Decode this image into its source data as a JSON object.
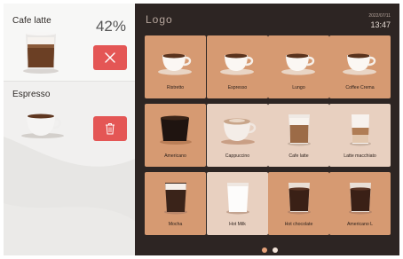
{
  "queue": [
    {
      "name": "Cafe latte",
      "progress_text": "42%",
      "progress_fraction": 0.42
    },
    {
      "name": "Espresso"
    }
  ],
  "header": {
    "logo": "Logo",
    "date": "2022/07/11",
    "time": "13:47"
  },
  "products": [
    {
      "label": "Ristretto",
      "cup": "espresso"
    },
    {
      "label": "Espresso",
      "cup": "espresso"
    },
    {
      "label": "Lungo",
      "cup": "espresso"
    },
    {
      "label": "Coffee Crema",
      "cup": "espresso"
    },
    {
      "label": "Americano",
      "cup": "wide-dark"
    },
    {
      "label": "Cappuccino",
      "cup": "foam"
    },
    {
      "label": "Cafe latte",
      "cup": "glass-latte"
    },
    {
      "label": "Latte macchiato",
      "cup": "glass-layered"
    },
    {
      "label": "Mocha",
      "cup": "glass-foam"
    },
    {
      "label": "Hot Milk",
      "cup": "milk"
    },
    {
      "label": "Hot chocolate",
      "cup": "glass-dark"
    },
    {
      "label": "Americano L",
      "cup": "glass-dark"
    }
  ],
  "pagination": {
    "page_count": 2,
    "current_page": 2
  },
  "colors": {
    "panel_bg": "#2d2523",
    "tile": "#d69a72",
    "tile_highlight": "#e8d0c0",
    "cancel_red": "#e45655",
    "active_dot": "#e6a27a",
    "inactive_dot": "#f2e4da"
  }
}
